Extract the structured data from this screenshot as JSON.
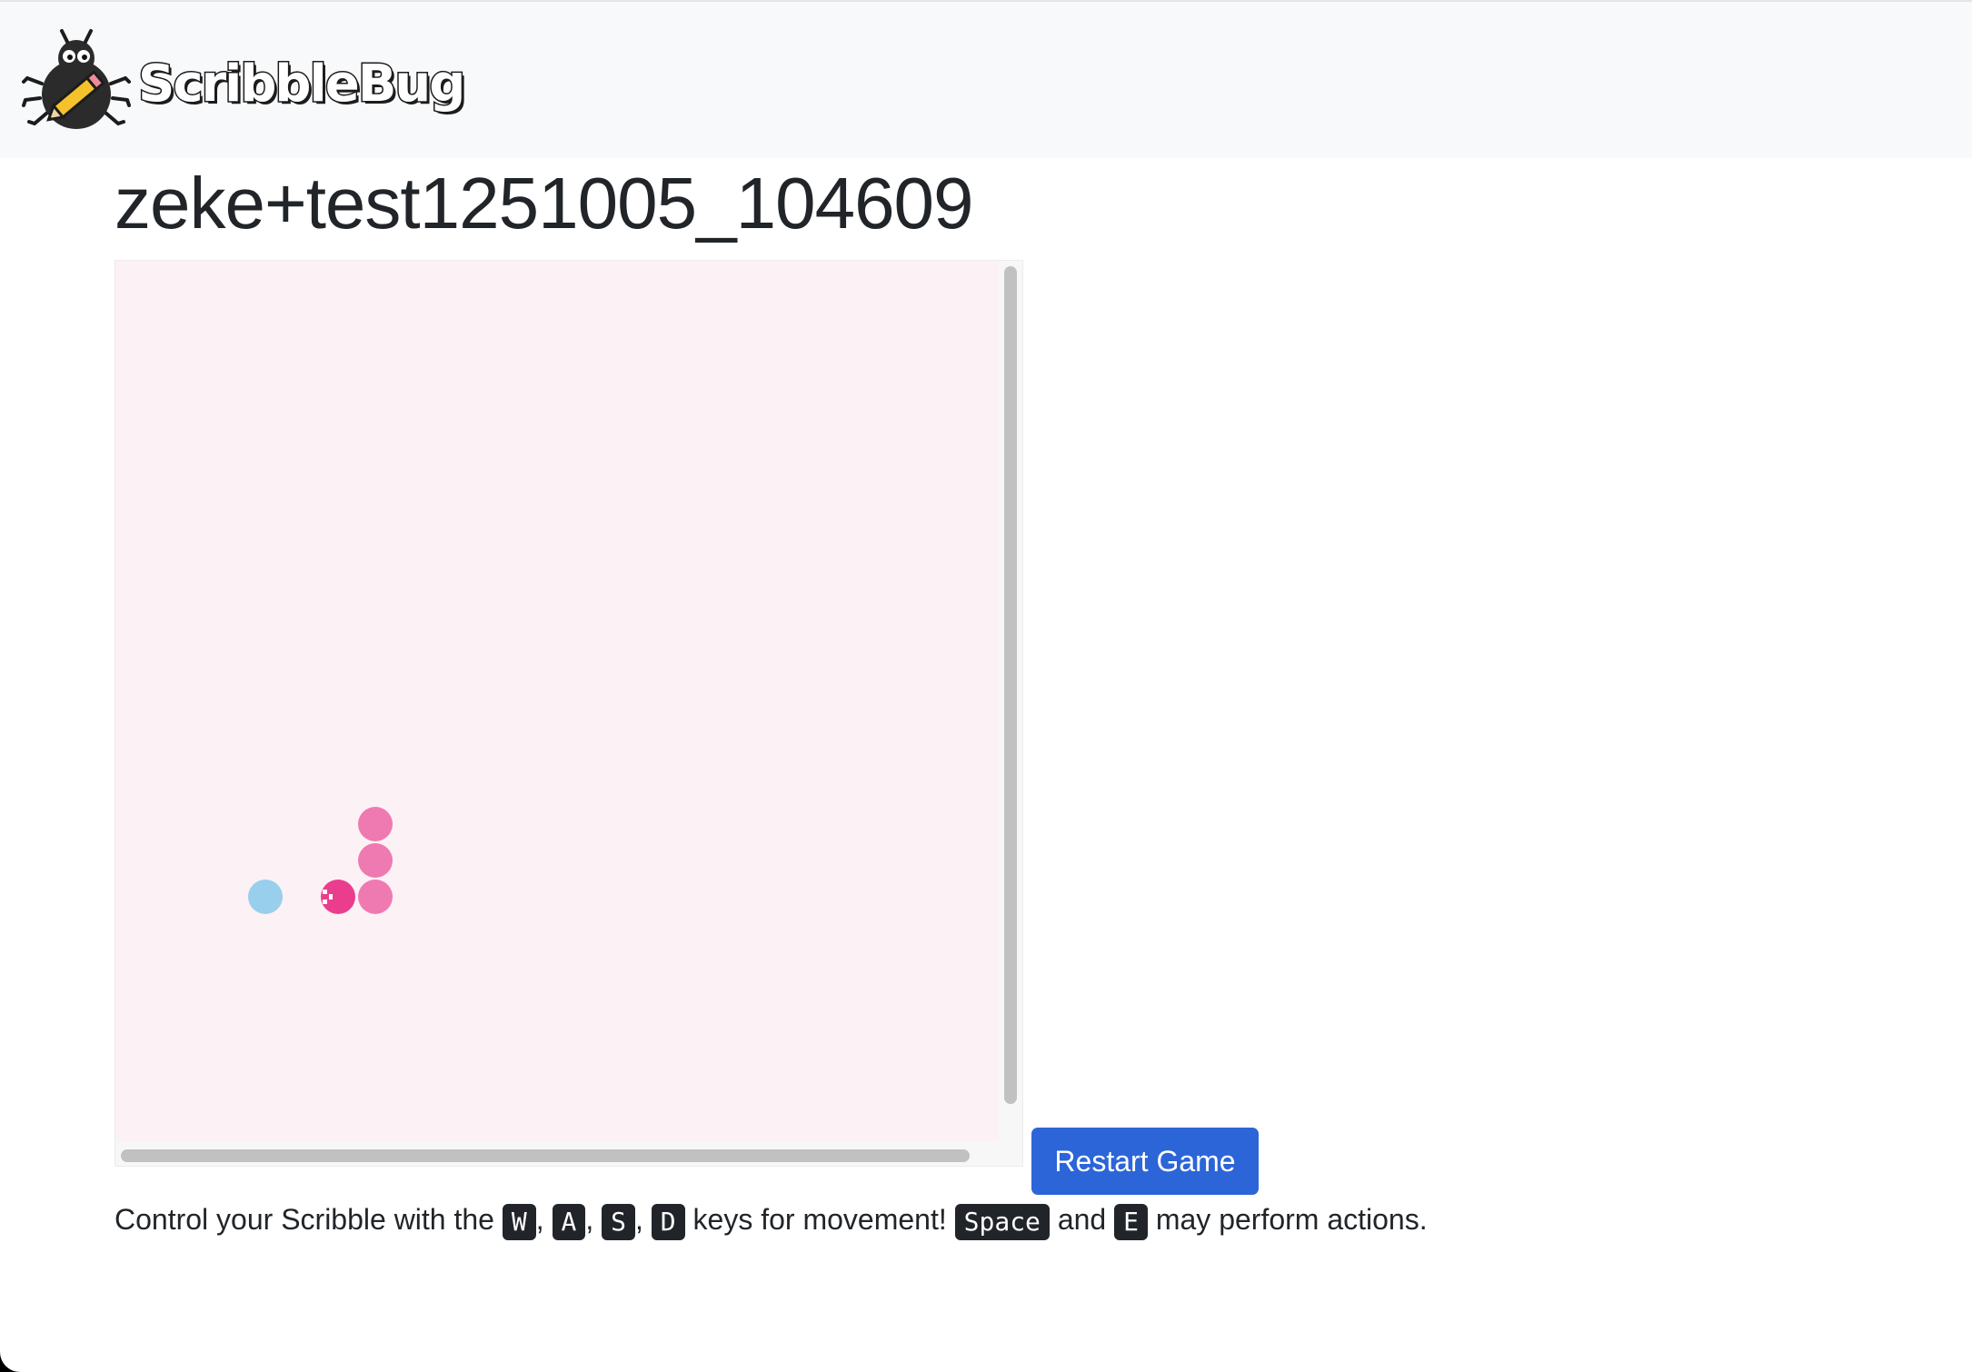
{
  "brand": {
    "name": "ScribbleBug"
  },
  "page": {
    "title": "zeke+test1251005_104609"
  },
  "game": {
    "canvas_color": "#fcf1f4",
    "player_color": "#ea3d8e",
    "body_color": "#ef79b1",
    "food_color": "#98cfed"
  },
  "controls": {
    "restart_label": "Restart Game",
    "intro": "Control your Scribble with the",
    "keys": [
      "W",
      "A",
      "S",
      "D"
    ],
    "sep": ",",
    "movement_text": "keys for movement!",
    "action_keys": [
      "Space",
      "E"
    ],
    "and_text": "and",
    "actions_text": "may perform actions."
  }
}
